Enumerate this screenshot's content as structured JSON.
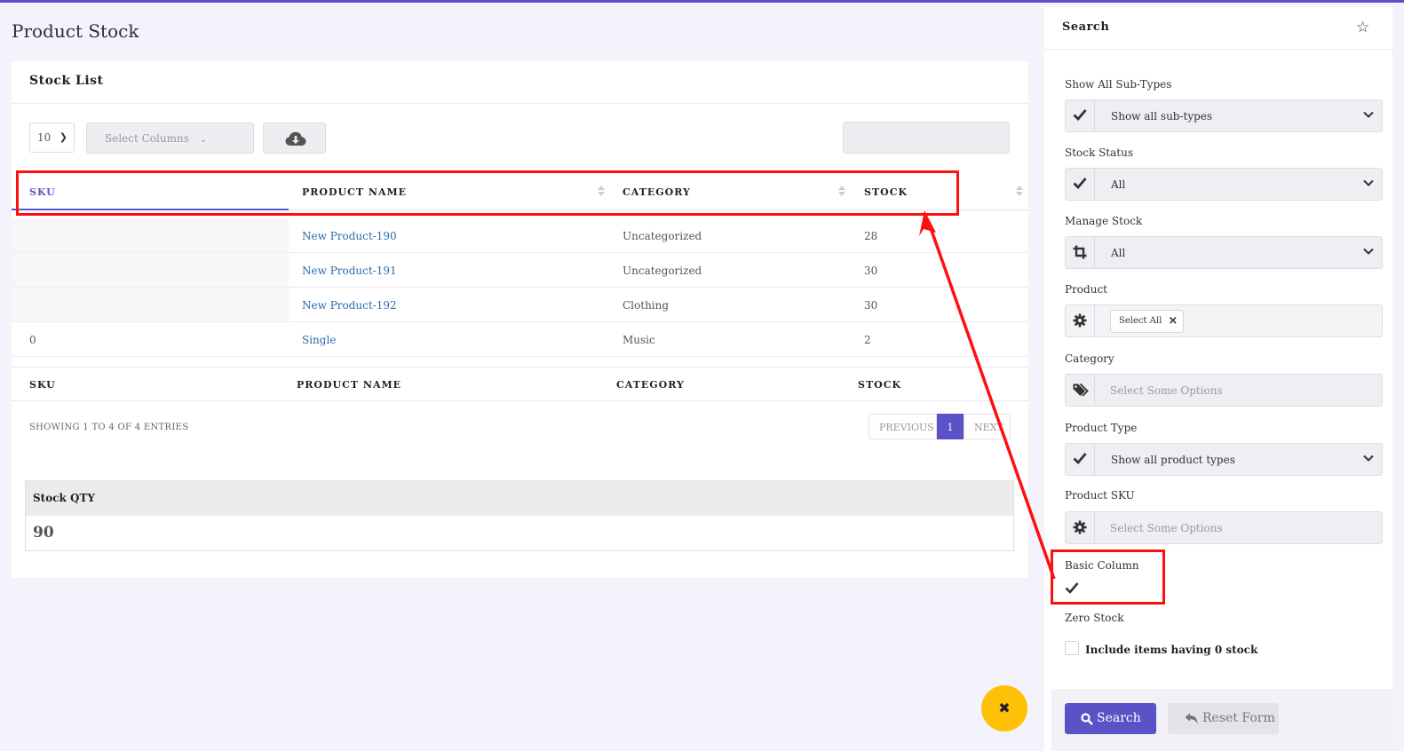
{
  "page": {
    "title": "Product Stock"
  },
  "stock_list": {
    "title": "Stock List",
    "length_value": "10",
    "select_columns_placeholder": "Select Columns",
    "columns": [
      "SKU",
      "PRODUCT NAME",
      "CATEGORY",
      "STOCK"
    ],
    "rows": [
      {
        "sku": "",
        "name": "New Product-190",
        "category": "Uncategorized",
        "stock": "28"
      },
      {
        "sku": "",
        "name": "New Product-191",
        "category": "Uncategorized",
        "stock": "30"
      },
      {
        "sku": "",
        "name": "New Product-192",
        "category": "Clothing",
        "stock": "30"
      },
      {
        "sku": "0",
        "name": "Single",
        "category": "Music",
        "stock": "2"
      }
    ],
    "footer_columns": [
      "SKU",
      "PRODUCT NAME",
      "CATEGORY",
      "STOCK"
    ],
    "info": "SHOWING 1 TO 4 OF 4 ENTRIES",
    "pagination": {
      "previous": "PREVIOUS",
      "current": "1",
      "next": "NEXT"
    }
  },
  "summary": {
    "label": "Stock QTY",
    "value": "90"
  },
  "search_panel": {
    "title": "Search",
    "fields": {
      "subtypes": {
        "label": "Show All Sub-Types",
        "value": "Show all sub-types"
      },
      "stock_status": {
        "label": "Stock Status",
        "value": "All"
      },
      "manage_stock": {
        "label": "Manage Stock",
        "value": "All"
      },
      "product": {
        "label": "Product",
        "tag": "Select All"
      },
      "category": {
        "label": "Category",
        "placeholder": "Select Some Options"
      },
      "product_type": {
        "label": "Product Type",
        "value": "Show all product types"
      },
      "product_sku": {
        "label": "Product SKU",
        "placeholder": "Select Some Options"
      },
      "basic_column": {
        "label": "Basic Column",
        "checked": true
      },
      "zero_stock": {
        "label": "Zero Stock",
        "option": "Include items having 0 stock",
        "checked": false
      }
    },
    "buttons": {
      "search": "Search",
      "reset": "Reset Form"
    }
  },
  "colors": {
    "accent": "#5b52c7",
    "link": "#2a6ba8",
    "highlight": "#ff1010",
    "fab": "#ffc107"
  },
  "icons": [
    "cloud-download-icon",
    "star-icon",
    "check-icon",
    "crop-icon",
    "gear-icon",
    "tags-icon",
    "search-icon",
    "undo-icon",
    "close-icon",
    "chevron-down-icon"
  ]
}
